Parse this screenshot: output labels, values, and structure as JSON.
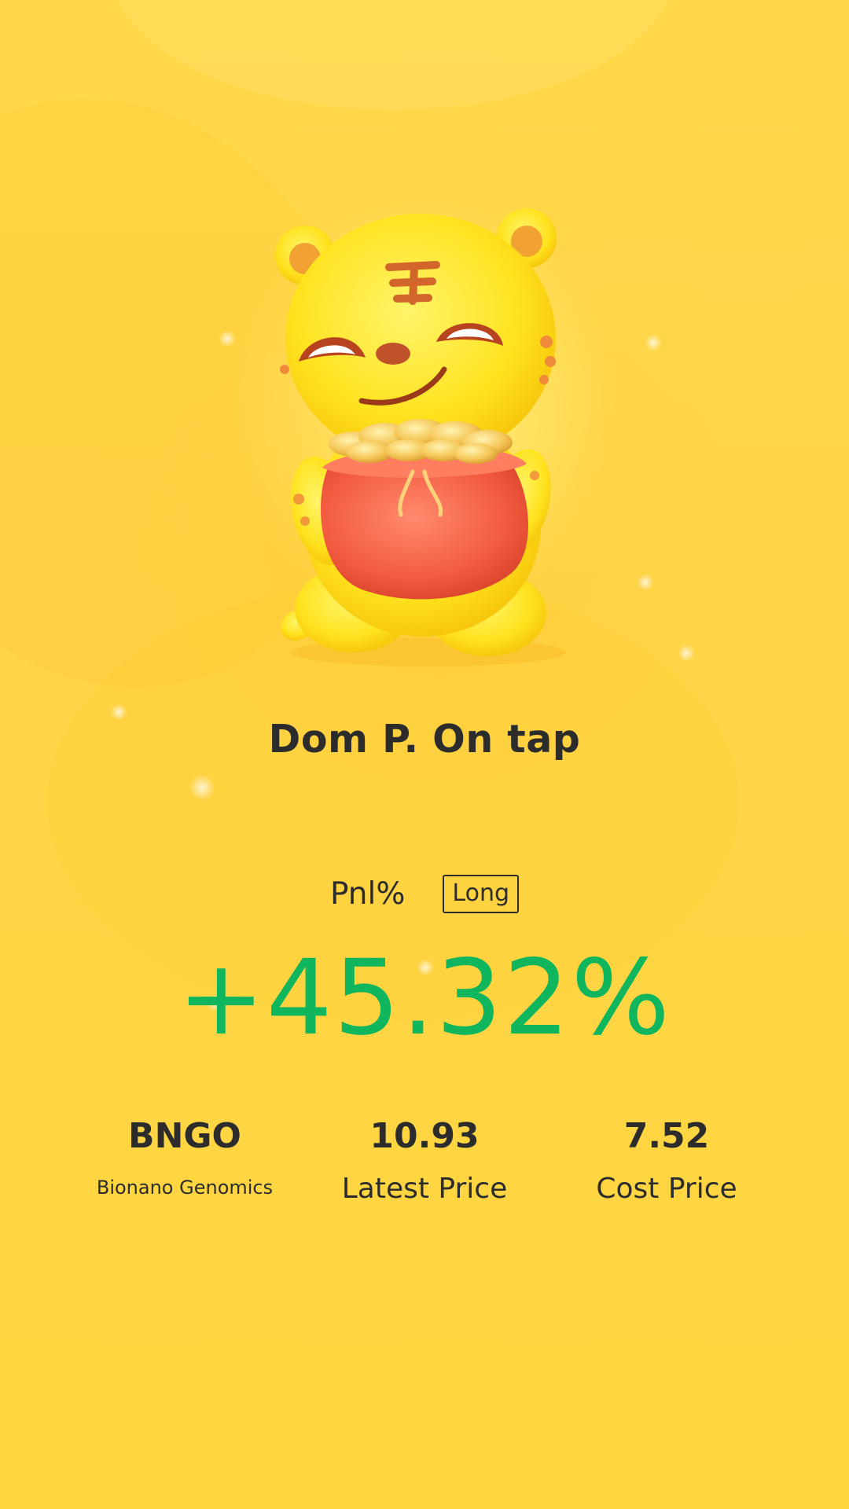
{
  "card": {
    "name": "Dom P. On tap",
    "pnl_label": "Pnl%",
    "direction": "Long",
    "pnl_value": "+45.32%",
    "pnl_color": "#10b65d",
    "background_color": "#ffd84a",
    "mascot": "tiger-with-money-bag"
  },
  "stats": {
    "ticker": "BNGO",
    "company": "Bionano Genomics",
    "latest_price": "10.93",
    "latest_price_label": "Latest Price",
    "cost_price": "7.52",
    "cost_price_label": "Cost Price"
  }
}
